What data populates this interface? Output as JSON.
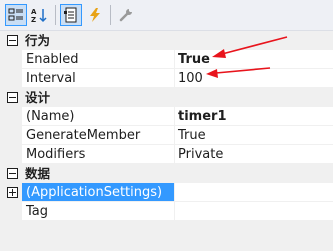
{
  "toolbar": {
    "buttons": [
      {
        "name": "categorized-icon",
        "active": true
      },
      {
        "name": "alphabetical-icon",
        "active": false
      },
      {
        "name": "properties-icon",
        "active": true
      },
      {
        "name": "events-icon",
        "active": false
      },
      {
        "name": "property-pages-icon",
        "active": false
      }
    ]
  },
  "categories": [
    {
      "label": "行为",
      "properties": [
        {
          "name": "Enabled",
          "value": "True"
        },
        {
          "name": "Interval",
          "value": "100"
        }
      ]
    },
    {
      "label": "设计",
      "properties": [
        {
          "name": "(Name)",
          "value": "timer1"
        },
        {
          "name": "GenerateMember",
          "value": "True"
        },
        {
          "name": "Modifiers",
          "value": "Private"
        }
      ]
    },
    {
      "label": "数据",
      "properties": [
        {
          "name": "(ApplicationSettings)",
          "value": ""
        },
        {
          "name": "Tag",
          "value": ""
        }
      ]
    }
  ],
  "colors": {
    "selection": "#3399ff",
    "arrow": "#e8141c",
    "gutter": "#f0f0f0"
  }
}
